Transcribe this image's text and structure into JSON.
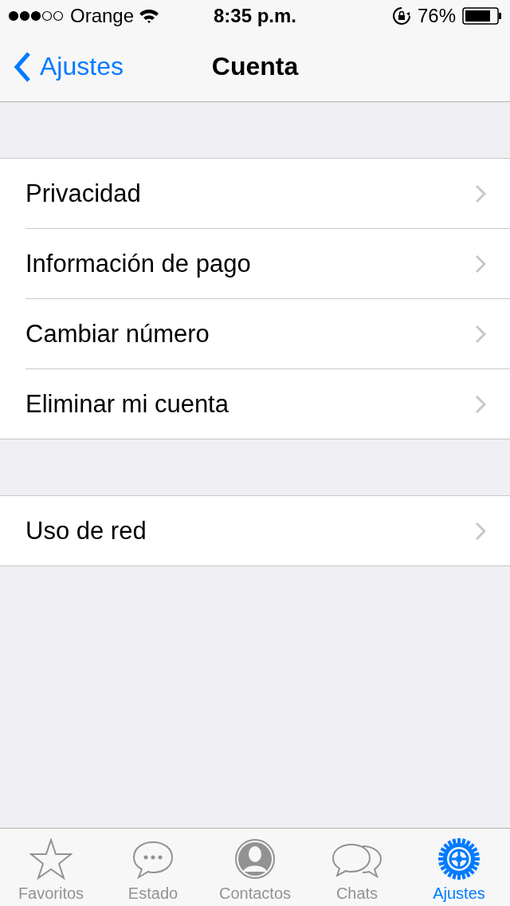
{
  "status_bar": {
    "carrier": "Orange",
    "time": "8:35 p.m.",
    "battery": "76%"
  },
  "nav_bar": {
    "back": "Ajustes",
    "title": "Cuenta"
  },
  "sections": [
    {
      "rows": [
        {
          "label": "Privacidad"
        },
        {
          "label": "Información de pago"
        },
        {
          "label": "Cambiar número"
        },
        {
          "label": "Eliminar mi cuenta"
        }
      ]
    },
    {
      "rows": [
        {
          "label": "Uso de red"
        }
      ]
    }
  ],
  "tab_bar": [
    {
      "label": "Favoritos",
      "kind": "star",
      "selected": false
    },
    {
      "label": "Estado",
      "kind": "bubble",
      "selected": false
    },
    {
      "label": "Contactos",
      "kind": "person",
      "selected": false
    },
    {
      "label": "Chats",
      "kind": "bubbles",
      "selected": false
    },
    {
      "label": "Ajustes",
      "kind": "gear",
      "selected": true
    }
  ]
}
